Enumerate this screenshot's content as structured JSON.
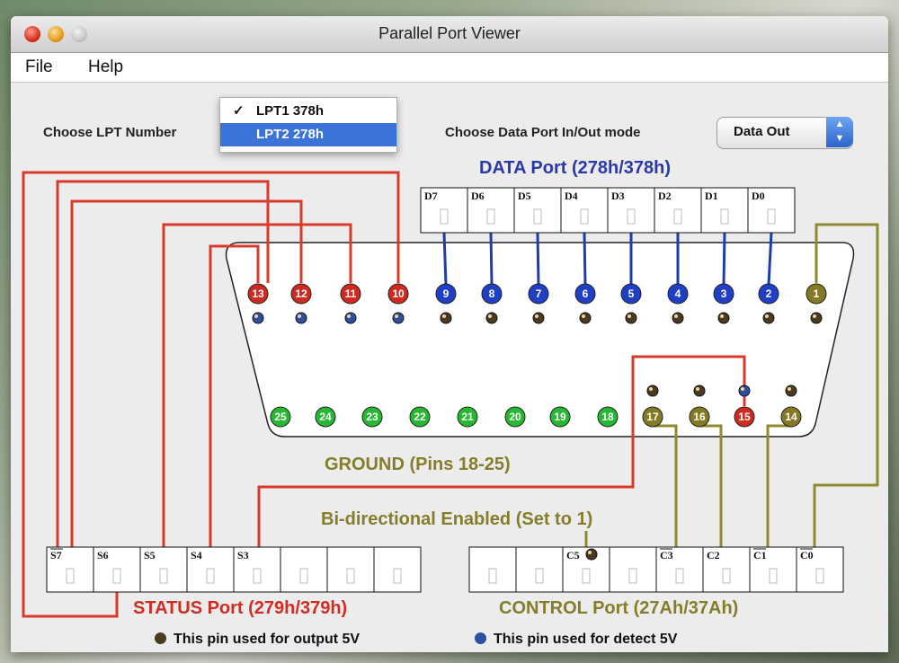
{
  "window": {
    "title": "Parallel Port Viewer"
  },
  "menu": {
    "file": "File",
    "help": "Help"
  },
  "controls": {
    "lpt_label": "Choose LPT Number",
    "lpt_options": [
      "LPT1  378h",
      "LPT2  278h"
    ],
    "lpt_checked_mark": "✓",
    "mode_label": "Choose Data Port In/Out mode",
    "mode_value": "Data Out",
    "mode_stepper_up": "▲",
    "mode_stepper_down": "▼"
  },
  "data_port": {
    "title": "DATA Port (278h/378h)",
    "cells": [
      "D7",
      "D6",
      "D5",
      "D4",
      "D3",
      "D2",
      "D1",
      "D0"
    ]
  },
  "status_port": {
    "title": "STATUS Port (279h/379h)",
    "cells": [
      "S7",
      "S6",
      "S5",
      "S4",
      "S3",
      "",
      "",
      ""
    ]
  },
  "control_port": {
    "title": "CONTROL Port (27Ah/37Ah)",
    "cells": [
      "",
      "",
      "C5",
      "",
      "C3",
      "C2",
      "C1",
      "C0"
    ]
  },
  "connector": {
    "top_pins": [
      "13",
      "12",
      "11",
      "10",
      "9",
      "8",
      "7",
      "6",
      "5",
      "4",
      "3",
      "2",
      "1"
    ],
    "bottom_pins": [
      "25",
      "24",
      "23",
      "22",
      "21",
      "20",
      "19",
      "18",
      "17",
      "16",
      "15",
      "14"
    ],
    "ground_label": "GROUND (Pins 18-25)",
    "bidirectional_label": "Bi-directional Enabled (Set to 1)"
  },
  "legend": {
    "output": "This pin used for output 5V",
    "detect": "This pin used for detect 5V"
  },
  "colors": {
    "red_pin": "#cf2a1f",
    "blue_pin": "#1f3fc6",
    "olive_pin": "#857a24",
    "green_pin": "#26b832",
    "red_wire": "#d93a2c",
    "blue_wire": "#1d3ea8",
    "olive_wire": "#8f8a2e",
    "output_icon": "#4b3a22",
    "detect_icon": "#2c4fa0"
  }
}
